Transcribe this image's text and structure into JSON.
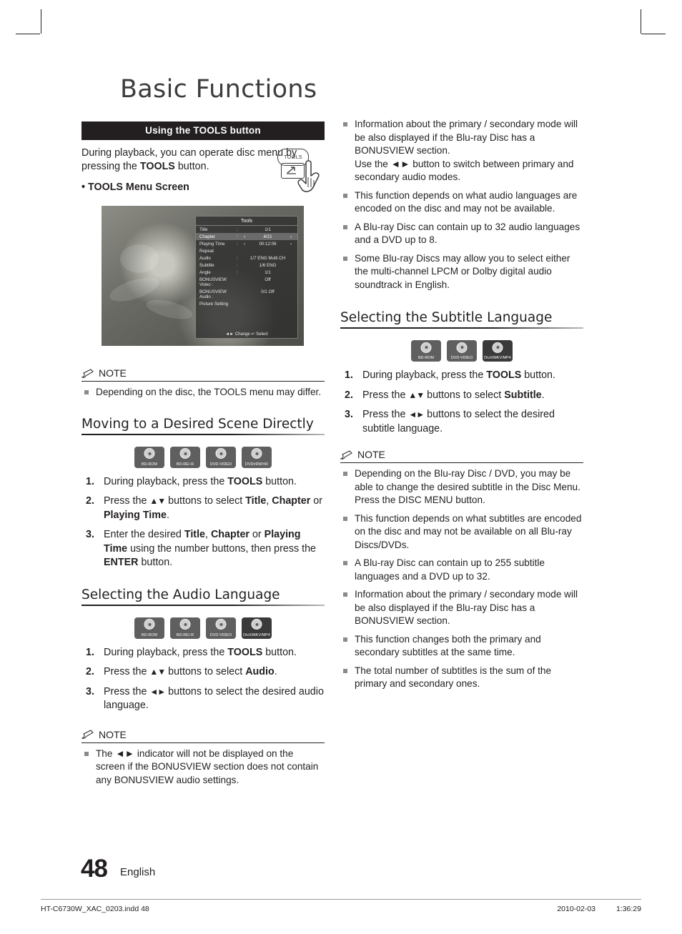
{
  "title": "Basic Functions",
  "left": {
    "bar_label": "Using the TOOLS button",
    "intro_pre": "During playback, you can operate disc menu by pressing the ",
    "intro_bold": "TOOLS",
    "intro_post": " button.",
    "bullet": "• TOOLS Menu Screen",
    "tools_button_label": "TOOLS",
    "screen": {
      "title": "Tools",
      "rows": [
        {
          "k": "Title",
          "c": ":",
          "v": "1/1",
          "sel": false,
          "arrows": false
        },
        {
          "k": "Chapter",
          "c": ":",
          "v": "4/21",
          "sel": true,
          "arrows": true
        },
        {
          "k": "Playing Time",
          "c": ":",
          "v": "00:12:06",
          "sel": false,
          "arrows": true
        },
        {
          "k": "Repeat",
          "c": "",
          "v": "",
          "sel": false,
          "arrows": false
        },
        {
          "k": "Audio",
          "c": ":",
          "v": "1/7 ENG Multi CH",
          "sel": false,
          "arrows": false
        },
        {
          "k": "Subtitle",
          "c": ":",
          "v": "1/6 ENG",
          "sel": false,
          "arrows": false
        },
        {
          "k": "Angle",
          "c": ":",
          "v": "1/1",
          "sel": false,
          "arrows": false
        },
        {
          "k": "BONUSVIEW Video :",
          "c": "",
          "v": "Off",
          "sel": false,
          "arrows": false
        },
        {
          "k": "BONUSVIEW Audio :",
          "c": "",
          "v": "0/1 Off",
          "sel": false,
          "arrows": false
        },
        {
          "k": "Picture Setting",
          "c": "",
          "v": "",
          "sel": false,
          "arrows": false
        }
      ],
      "footer": "◄► Change   ↵ Select"
    },
    "note_label": "NOTE",
    "note_items": [
      "Depending on the disc, the TOOLS menu may differ."
    ],
    "section_scene": "Moving to a Desired Scene Directly",
    "badges_scene": [
      {
        "label": "BD-ROM",
        "dark": false
      },
      {
        "label": "BD-RE/-R",
        "dark": false
      },
      {
        "label": "DVD-VIDEO",
        "dark": false
      },
      {
        "label": "DVD±RW/±R",
        "dark": false
      }
    ],
    "steps_scene": [
      {
        "num": "1.",
        "html": "During playback, press the <b>TOOLS</b> button."
      },
      {
        "num": "2.",
        "html": "Press the <span class=\"tri\">▲▼</span> buttons to select <b>Title</b>, <b>Chapter</b> or <b>Playing Time</b>."
      },
      {
        "num": "3.",
        "html": "Enter the desired <b>Title</b>, <b>Chapter</b> or <b>Playing Time</b> using the number buttons, then press the <b>ENTER</b> button."
      }
    ],
    "section_audio": "Selecting the Audio Language",
    "badges_audio": [
      {
        "label": "BD-ROM",
        "dark": false
      },
      {
        "label": "BD-RE/-R",
        "dark": false
      },
      {
        "label": "DVD-VIDEO",
        "dark": false
      },
      {
        "label": "DivX/MKV/MP4",
        "dark": true
      }
    ],
    "steps_audio": [
      {
        "num": "1.",
        "html": "During playback, press the <b>TOOLS</b> button."
      },
      {
        "num": "2.",
        "html": "Press the <span class=\"tri\">▲▼</span> buttons to select <b>Audio</b>."
      },
      {
        "num": "3.",
        "html": "Press the <span class=\"tri\">◄►</span> buttons to select the desired audio language."
      }
    ],
    "note2_label": "NOTE",
    "note2_items": [
      "The ◄► indicator will not be displayed on the screen if the BONUSVIEW section does not contain any BONUSVIEW audio settings."
    ]
  },
  "right": {
    "top_notes": [
      "Information about the primary / secondary mode will be also displayed if the Blu-ray Disc has a BONUSVIEW section.\nUse the ◄► button to switch between primary and secondary audio modes.",
      "This function depends on what audio languages are encoded on the disc and may not be available.",
      "A Blu-ray Disc can contain up to 32 audio languages and a DVD up to 8.",
      "Some Blu-ray Discs may allow you to select either the multi-channel LPCM or Dolby digital audio soundtrack in English."
    ],
    "section_subtitle": "Selecting the Subtitle Language",
    "badges_subtitle": [
      {
        "label": "BD-ROM",
        "dark": false
      },
      {
        "label": "DVD-VIDEO",
        "dark": false
      },
      {
        "label": "DivX/MKV/MP4",
        "dark": true
      }
    ],
    "steps_subtitle": [
      {
        "num": "1.",
        "html": "During playback, press the <b>TOOLS</b> button."
      },
      {
        "num": "2.",
        "html": "Press the <span class=\"tri\">▲▼</span> buttons to select <b>Subtitle</b>."
      },
      {
        "num": "3.",
        "html": "Press the <span class=\"tri\">◄►</span> buttons to select the desired subtitle language."
      }
    ],
    "note_label": "NOTE",
    "note_items": [
      "Depending on the Blu-ray Disc / DVD, you may be able to change the desired subtitle in the Disc Menu.\nPress the DISC MENU button.",
      "This function depends on what subtitles are encoded on the disc and may not be available on all Blu-ray Discs/DVDs.",
      "A Blu-ray Disc can contain up to 255 subtitle languages and a DVD up to 32.",
      "Information about the primary / secondary mode will be also displayed if the Blu-ray Disc has a BONUSVIEW section.",
      "This function changes both the primary and secondary subtitles at the same time.",
      "The total number of subtitles is the sum of the primary and secondary ones."
    ]
  },
  "footer": {
    "page_number": "48",
    "language": "English",
    "file": "HT-C6730W_XAC_0203.indd   48",
    "date": "2010-02-03",
    "time": "1:36:29"
  }
}
